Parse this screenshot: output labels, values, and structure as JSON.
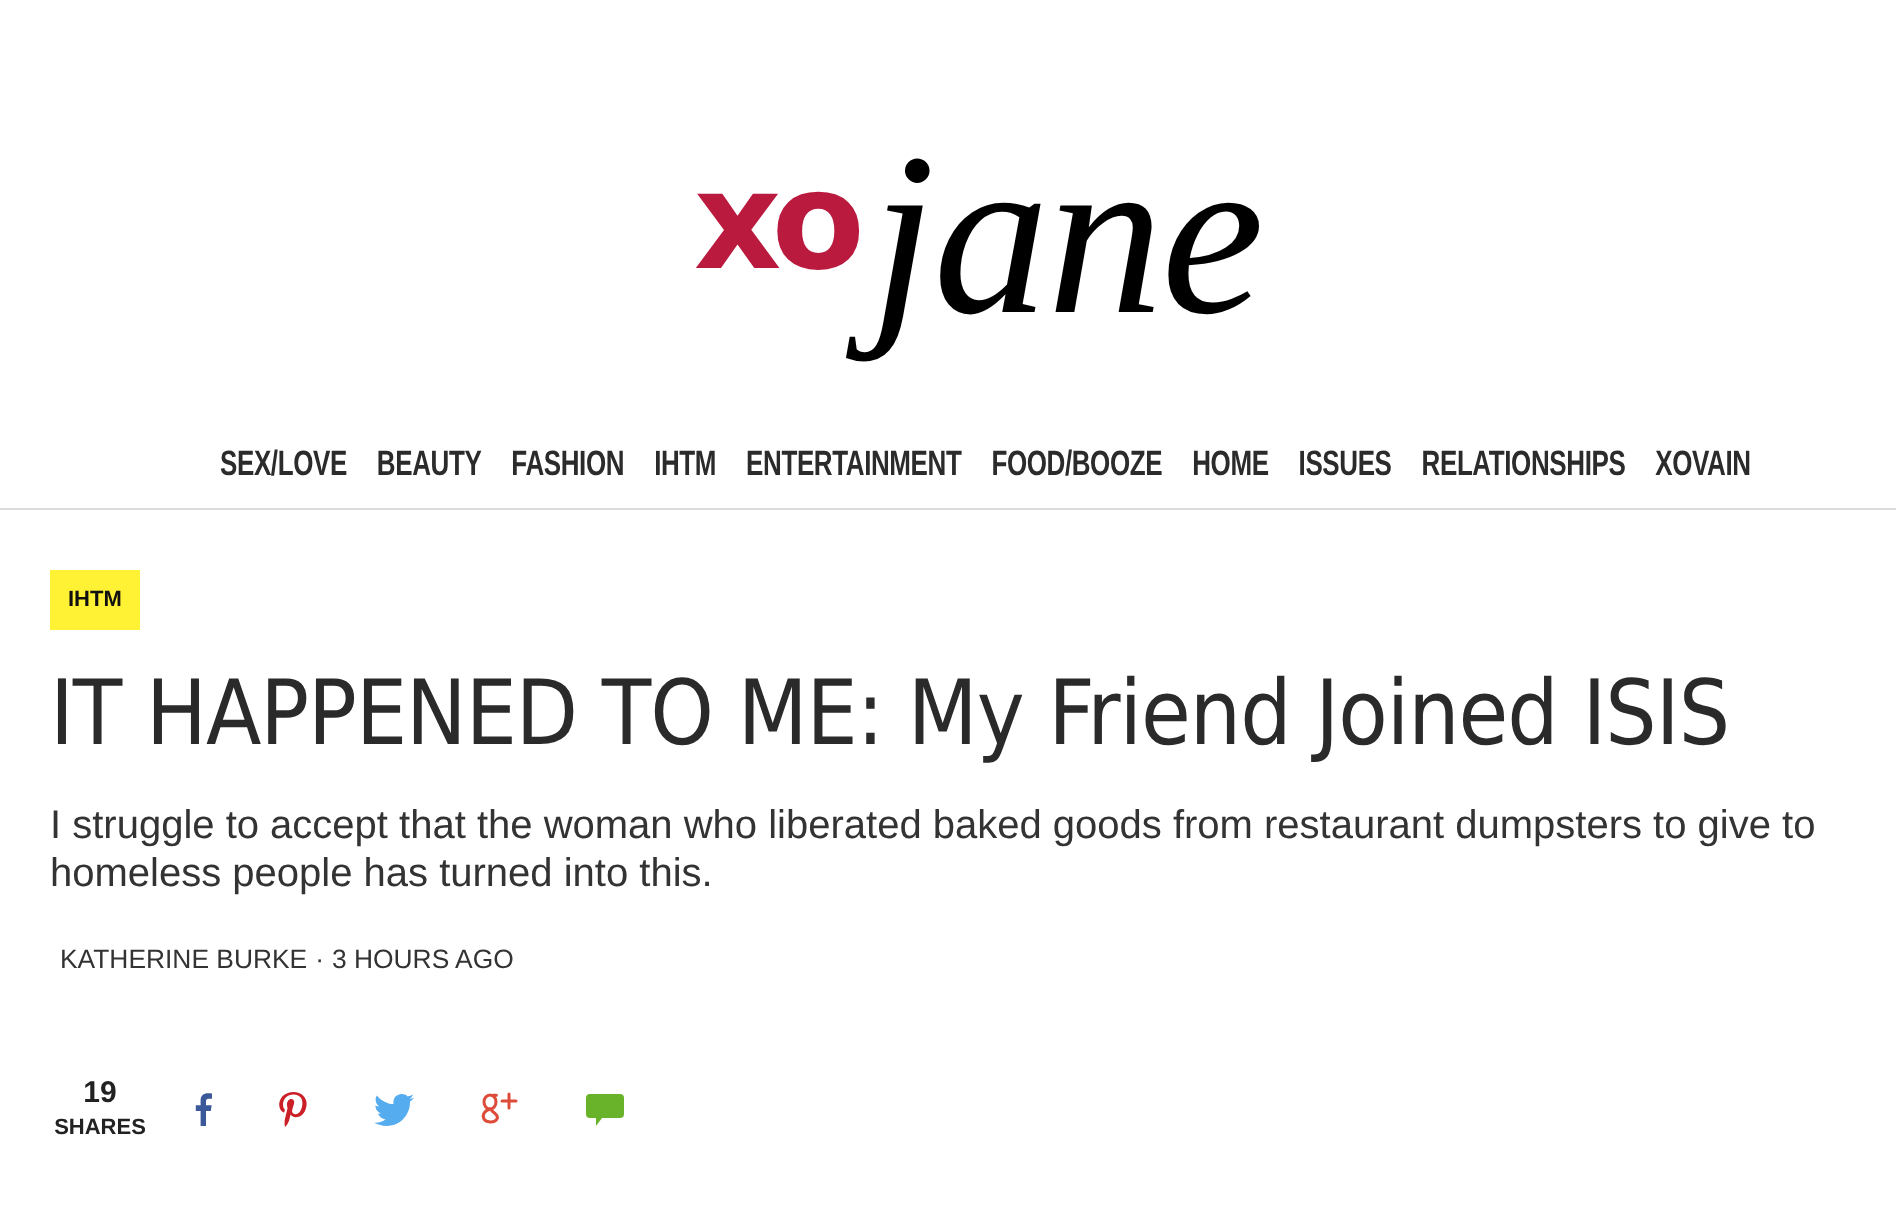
{
  "logo": {
    "mark": "xo",
    "script": "jane"
  },
  "nav": {
    "items": [
      {
        "label": "SEX/LOVE"
      },
      {
        "label": "BEAUTY"
      },
      {
        "label": "FASHION"
      },
      {
        "label": "IHTM"
      },
      {
        "label": "ENTERTAINMENT"
      },
      {
        "label": "FOOD/BOOZE"
      },
      {
        "label": "HOME"
      },
      {
        "label": "ISSUES"
      },
      {
        "label": "RELATIONSHIPS"
      },
      {
        "label": "XOVAIN"
      }
    ]
  },
  "article": {
    "tag": "IHTM",
    "title": "IT HAPPENED TO ME: My Friend Joined ISIS",
    "dek": "I struggle to accept that the woman who liberated baked goods from restaurant dumpsters to give to homeless people has turned into this.",
    "byline": {
      "author": "KATHERINE BURKE",
      "separator": "·",
      "time": "3 HOURS AGO"
    }
  },
  "share": {
    "count": "19",
    "label": "SHARES",
    "buttons": [
      {
        "kind": "facebook"
      },
      {
        "kind": "pinterest"
      },
      {
        "kind": "twitter"
      },
      {
        "kind": "google_plus"
      },
      {
        "kind": "comment"
      }
    ]
  }
}
